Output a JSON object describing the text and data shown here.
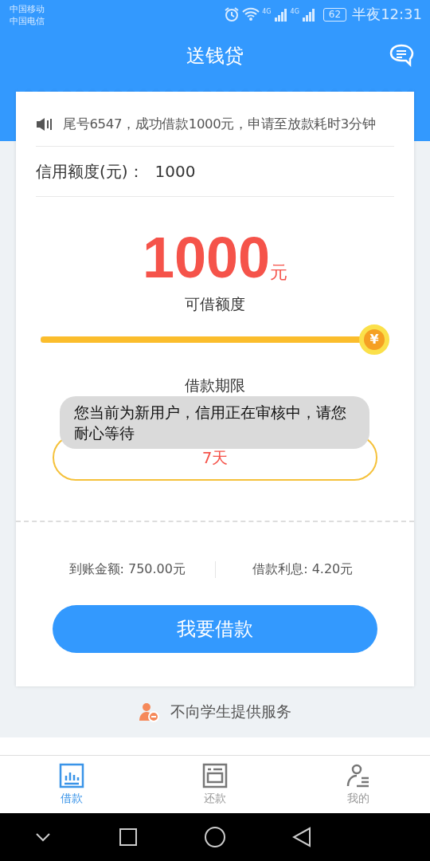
{
  "status_bar": {
    "carriers": [
      "中国移动",
      "中国电信"
    ],
    "network_labels": [
      "4G",
      "4G"
    ],
    "battery": "62",
    "time": "半夜12:31"
  },
  "header": {
    "title": "送钱贷"
  },
  "notice": "尾号6547，成功借款1000元，申请至放款耗时3分钟",
  "credit_line": {
    "label": "信用额度(元)：",
    "value": "1000"
  },
  "amount": {
    "value": "1000",
    "unit": "元",
    "caption": "可借额度"
  },
  "slider": {
    "level": 1,
    "thumb_symbol": "¥"
  },
  "period": {
    "label": "借款期限",
    "value": "7天"
  },
  "summary": [
    "到账金额: 750.00元",
    "借款利息: 4.20元"
  ],
  "button": "我要借款",
  "student_notice": "不向学生提供服务",
  "toast": "您当前为新用户，信用正在审核中，请您耐心等待",
  "tabs": [
    {
      "label": "借款",
      "kind": "chart",
      "selected": true
    },
    {
      "label": "还款",
      "kind": "form",
      "selected": false
    },
    {
      "label": "我的",
      "kind": "person",
      "selected": false
    }
  ]
}
